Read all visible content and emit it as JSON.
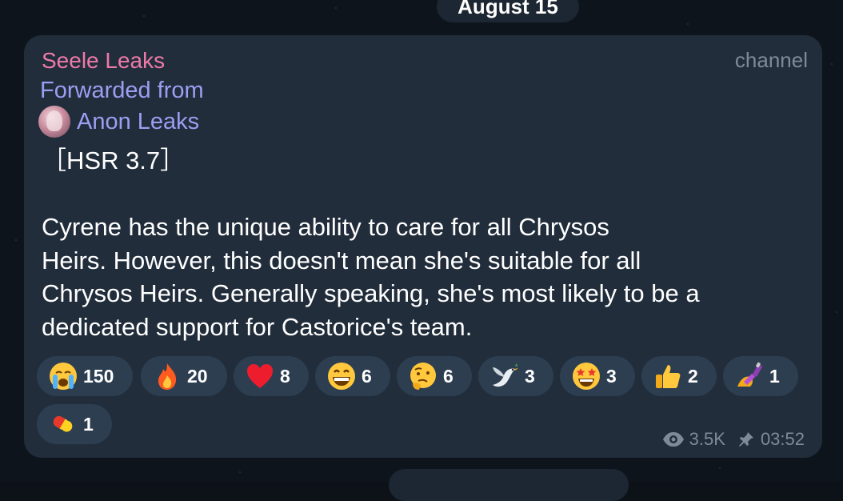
{
  "date_header": "August 15",
  "bottom_service": "",
  "message": {
    "sender": "Seele Leaks",
    "tag": "channel",
    "forwarded_label": "Forwarded from",
    "forwarded_name": "Anon Leaks",
    "text": "［HSR 3.7］\n\nCyrene has the unique ability to care for all Chrysos\nHeirs. However, this doesn't mean she's suitable for all\nChrysos Heirs. Generally speaking, she's most likely to be a\ndedicated support for Castorice's team.",
    "views": "3.5K",
    "time": "03:52"
  },
  "reactions": [
    {
      "icon": "crying-face",
      "count": "150"
    },
    {
      "icon": "fire",
      "count": "20"
    },
    {
      "icon": "red-heart",
      "count": "8"
    },
    {
      "icon": "grinning-face",
      "count": "6"
    },
    {
      "icon": "thinking-face",
      "count": "6"
    },
    {
      "icon": "dove",
      "count": "3"
    },
    {
      "icon": "star-struck",
      "count": "3"
    },
    {
      "icon": "thumbs-up",
      "count": "2"
    },
    {
      "icon": "nail-polish",
      "count": "1"
    },
    {
      "icon": "pill",
      "count": "1"
    }
  ],
  "colors": {
    "sender": "#ee7aa8",
    "forwarded": "#9b9ff2",
    "bubble": "#212d3b",
    "reaction_bg": "#2d3e51",
    "meta": "#7d8b99"
  }
}
